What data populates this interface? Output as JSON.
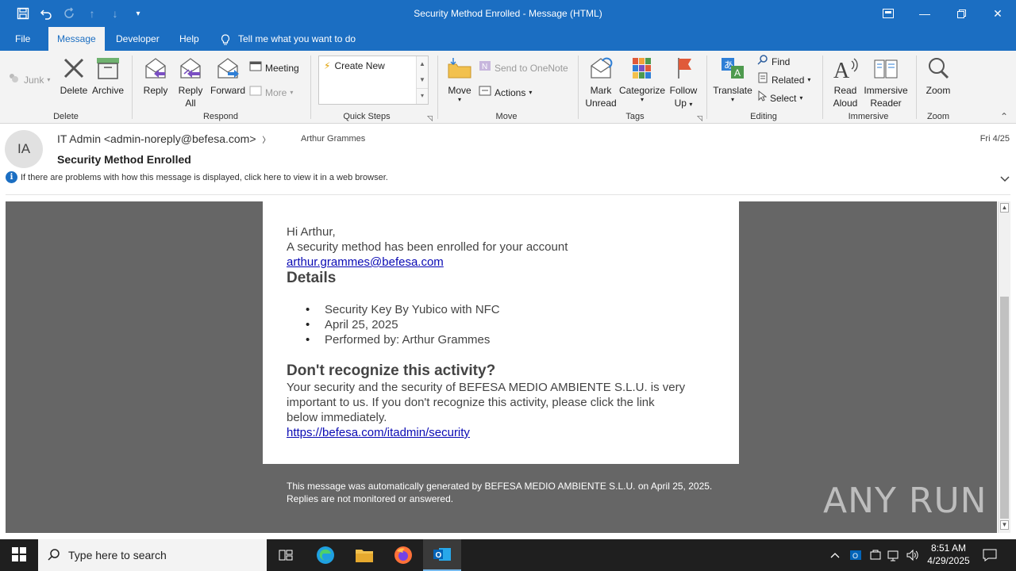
{
  "window": {
    "title": "Security Method Enrolled  -  Message (HTML)"
  },
  "tabs": [
    {
      "label": "File"
    },
    {
      "label": "Message"
    },
    {
      "label": "Developer"
    },
    {
      "label": "Help"
    }
  ],
  "tell_me": "Tell me what you want to do",
  "ribbon": {
    "delete_group": {
      "label": "Delete",
      "junk": "Junk",
      "delete": "Delete",
      "archive": "Archive"
    },
    "respond_group": {
      "label": "Respond",
      "reply": "Reply",
      "reply_all_1": "Reply",
      "reply_all_2": "All",
      "forward": "Forward",
      "meeting": "Meeting",
      "more": "More"
    },
    "quicksteps_group": {
      "label": "Quick Steps",
      "create_new": "Create New"
    },
    "move_group": {
      "label": "Move",
      "move": "Move",
      "send_onenote": "Send to OneNote",
      "actions": "Actions"
    },
    "tags_group": {
      "label": "Tags",
      "mark_unread_1": "Mark",
      "mark_unread_2": "Unread",
      "categorize": "Categorize",
      "follow_up_1": "Follow",
      "follow_up_2": "Up"
    },
    "editing_group": {
      "label": "Editing",
      "translate": "Translate",
      "find": "Find",
      "related": "Related",
      "select": "Select"
    },
    "immersive_group": {
      "label": "Immersive",
      "read_aloud_1": "Read",
      "read_aloud_2": "Aloud",
      "immersive_reader_1": "Immersive",
      "immersive_reader_2": "Reader"
    },
    "zoom_group": {
      "label": "Zoom",
      "zoom": "Zoom"
    }
  },
  "message": {
    "avatar_initials": "IA",
    "from": "IT Admin <admin-noreply@befesa.com>",
    "to": "Arthur Grammes",
    "date": "Fri 4/25",
    "subject": "Security Method Enrolled",
    "info_bar": "If there are problems with how this message is displayed, click here to view it in a web browser."
  },
  "email_body": {
    "greeting": "Hi Arthur,",
    "line1": "A security method has been enrolled for your account",
    "account_link": "arthur.grammes@befesa.com",
    "details_heading": "Details",
    "details": [
      "Security Key By Yubico with NFC",
      "April 25, 2025",
      "Performed by: Arthur Grammes"
    ],
    "warning_heading": "Don't recognize this activity?",
    "warning_line1": "Your security and the security of BEFESA MEDIO AMBIENTE S.L.U. is very",
    "warning_line2": "important to us. If you don't recognize this activity, please click the link",
    "warning_line3": "below immediately.",
    "security_link": "https://befesa.com/itadmin/security",
    "footer_line1": "This message was automatically generated by BEFESA MEDIO AMBIENTE S.L.U. on April 25, 2025.",
    "footer_line2": "Replies are not monitored or answered.",
    "watermark": "ANY RUN"
  },
  "taskbar": {
    "search_placeholder": "Type here to search",
    "time": "8:51 AM",
    "date": "4/29/2025"
  },
  "colors": {
    "accent": "#1b6ec2",
    "body_bg": "#666666",
    "link": "#0a0ab4"
  }
}
